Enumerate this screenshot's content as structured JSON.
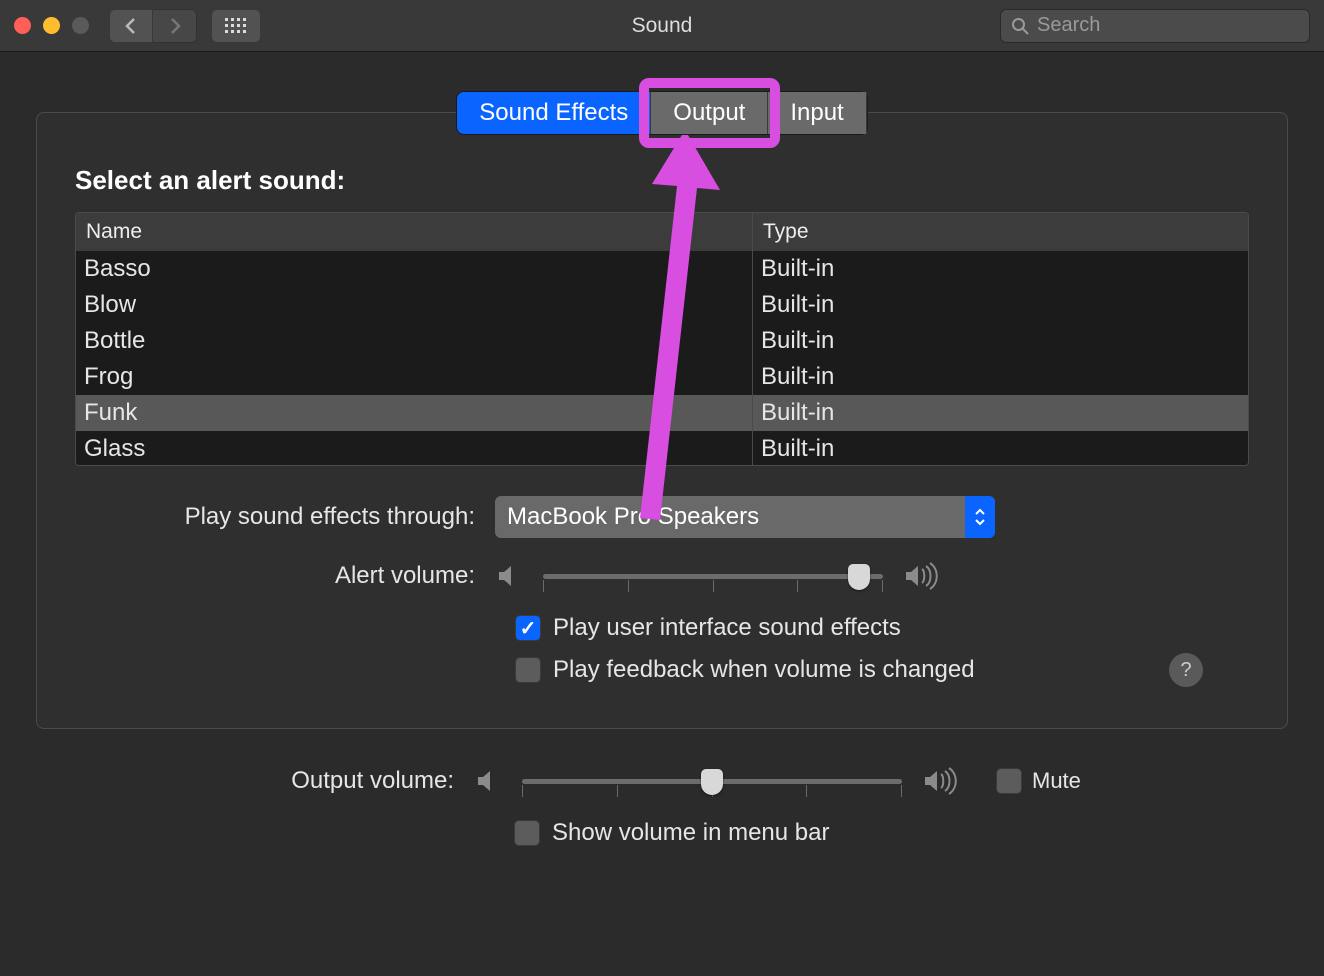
{
  "window": {
    "title": "Sound"
  },
  "toolbar": {
    "search_placeholder": "Search"
  },
  "tabs": {
    "sound_effects": "Sound Effects",
    "output": "Output",
    "input": "Input"
  },
  "section": {
    "title": "Select an alert sound:"
  },
  "table": {
    "headers": {
      "name": "Name",
      "type": "Type"
    },
    "rows": [
      {
        "name": "Basso",
        "type": "Built-in",
        "selected": false
      },
      {
        "name": "Blow",
        "type": "Built-in",
        "selected": false
      },
      {
        "name": "Bottle",
        "type": "Built-in",
        "selected": false
      },
      {
        "name": "Frog",
        "type": "Built-in",
        "selected": false
      },
      {
        "name": "Funk",
        "type": "Built-in",
        "selected": true
      },
      {
        "name": "Glass",
        "type": "Built-in",
        "selected": false
      }
    ]
  },
  "controls": {
    "play_through_label": "Play sound effects through:",
    "play_through_value": "MacBook Pro Speakers",
    "alert_volume_label": "Alert volume:",
    "alert_volume": 93,
    "play_ui_sounds": {
      "label": "Play user interface sound effects",
      "checked": true
    },
    "play_feedback": {
      "label": "Play feedback when volume is changed",
      "checked": false
    }
  },
  "footer": {
    "output_volume_label": "Output volume:",
    "output_volume": 50,
    "mute_label": "Mute",
    "mute_checked": false,
    "show_menu_label": "Show volume in menu bar",
    "show_menu_checked": false
  },
  "colors": {
    "accent": "#0a64ff",
    "annotation": "#d84ee0"
  }
}
